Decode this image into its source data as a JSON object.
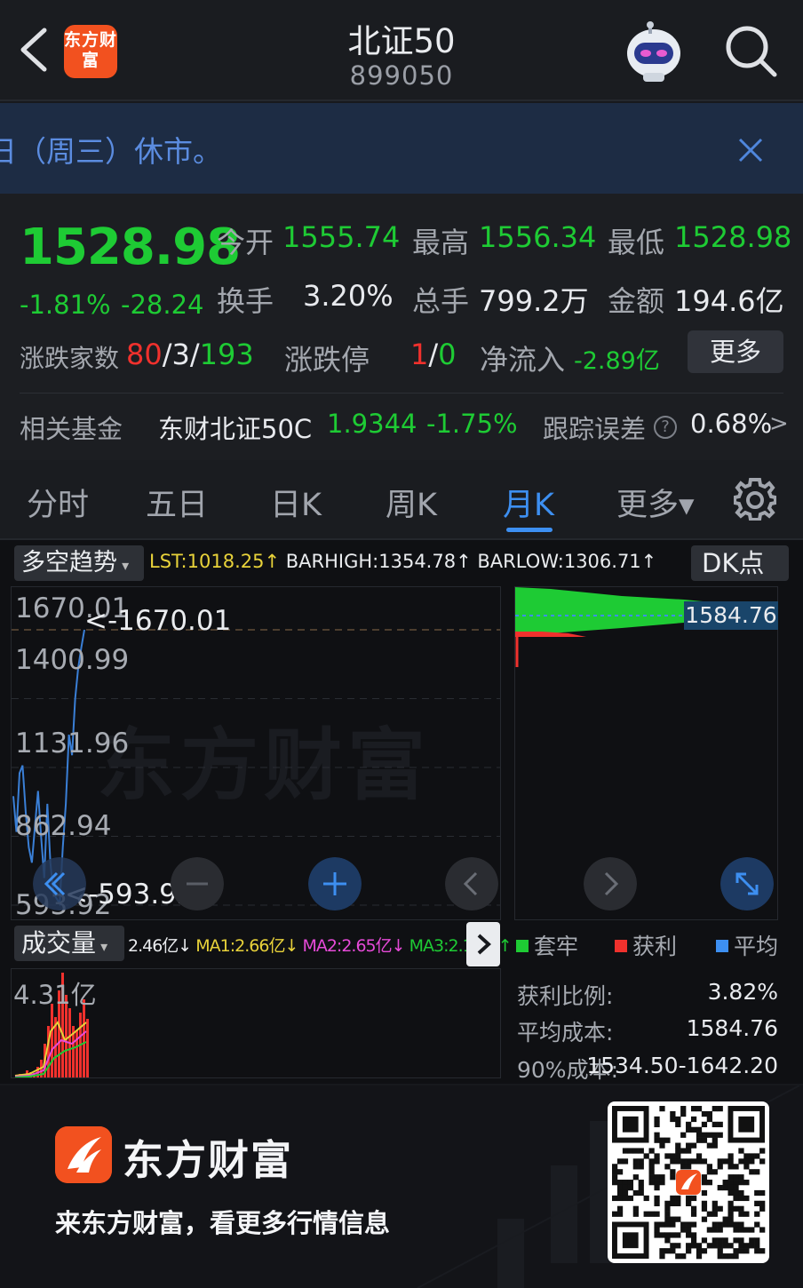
{
  "header": {
    "title": "北证50",
    "code": "899050",
    "app_logo_text": "东方财富"
  },
  "notice": {
    "text": "日（周三）休市。"
  },
  "quote": {
    "price": "1528.98",
    "change_pct": "-1.81%",
    "change": "-28.24",
    "open_label": "今开",
    "open": "1555.74",
    "high_label": "最高",
    "high": "1556.34",
    "low_label": "最低",
    "low": "1528.98",
    "turnover_label": "换手",
    "turnover": "3.20%",
    "volume_label": "总手",
    "volume": "799.2万",
    "amount_label": "金额",
    "amount": "194.6亿",
    "breadth_label": "涨跌家数",
    "breadth_up": "80",
    "breadth_flat": "3",
    "breadth_down": "193",
    "breadth_sep": "/",
    "limit_label": "涨跌停",
    "limit_up": "1",
    "limit_down": "0",
    "inflow_label": "净流入",
    "inflow": "-2.89亿",
    "more_label": "更多"
  },
  "fund": {
    "label": "相关基金",
    "name": "东财北证50C",
    "nav": "1.9344",
    "chg": "-1.75%",
    "error_label": "跟踪误差",
    "error_help": "?",
    "error_value": "0.68%",
    "arrow": ">"
  },
  "tabs": [
    {
      "label": "分时",
      "active": false
    },
    {
      "label": "五日",
      "active": false
    },
    {
      "label": "日K",
      "active": false
    },
    {
      "label": "周K",
      "active": false
    },
    {
      "label": "月K",
      "active": true
    },
    {
      "label": "更多▾",
      "active": false
    }
  ],
  "chart": {
    "indicator_select": "多空趋势",
    "dk_button": "DK点",
    "lst": "LST:1018.25↑",
    "barhigh": "BARHIGH:1354.78↑",
    "barlow": "BARLOW:1306.71↑",
    "y_labels": [
      "1670.01",
      "1400.99",
      "1131.96",
      "862.94",
      "593.92"
    ],
    "max_marker": "<-1670.01",
    "min_marker": "<-593.92",
    "watermark": "东方财富",
    "avg_cost_tag": "1584.76",
    "colors": {
      "up": "#f0312d",
      "down": "#1ecb34",
      "line": "#3a7fd6",
      "accent": "#3d8ff1"
    }
  },
  "chart_data": {
    "type": "line",
    "title": "",
    "ylim": [
      593.92,
      1670.01
    ],
    "series": [
      {
        "values": [
          1020,
          880,
          1110,
          1140,
          960,
          820,
          760,
          900,
          1040,
          860,
          700,
          990,
          760,
          640,
          620,
          600,
          820,
          990,
          1260,
          1180,
          1400,
          1520,
          1600,
          1670
        ]
      }
    ]
  },
  "volume": {
    "select": "成交量",
    "vol": "2.46亿↓",
    "ma1": "MA1:2.66亿↓",
    "ma2": "MA2:2.65亿↓",
    "ma3": "MA3:2.10亿↑",
    "max_label": "4.31亿"
  },
  "chip": {
    "legend": [
      {
        "label": "套牢",
        "color": "#1ecb34"
      },
      {
        "label": "获利",
        "color": "#f0312d"
      },
      {
        "label": "平均",
        "color": "#3d8ff1"
      }
    ],
    "profit_ratio_label": "获利比例:",
    "profit_ratio": "3.82%",
    "avg_cost_label": "平均成本:",
    "avg_cost": "1584.76",
    "cost90_label": "90%成本:",
    "cost90": "1534.50-1642.20"
  },
  "footer": {
    "brand": "东方财富",
    "slogan": "来东方财富，看更多行情信息"
  }
}
